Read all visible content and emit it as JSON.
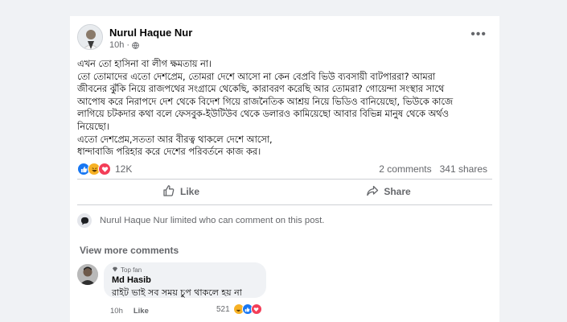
{
  "post": {
    "author": "Nurul Haque Nur",
    "time": "10h",
    "more_label": "•••",
    "lines": [
      "এখন তো হাসিনা বা লীগ ক্ষমতায় না।",
      "তো তোমাদের এতো দেশপ্রেম, তোমরা দেশে আসো না কেন বেপ্রবি ভিউ ব্যবসায়ী বাটপাররা? আমরা",
      "জীবনের ঝুঁকি নিয়ে রাজপথের সংগ্রামে থেকেছি, কারাবরণ করেছি আর তোমরা? গোয়েন্দা সংস্থার সাথে",
      "আপোষ করে নিরাপদে দেশ থেকে বিদেশ গিয়ে রাজনৈতিক আশ্রয় নিয়ে ভিডিও বানিয়েছো, ভিউকে কাজে",
      "লাগিয়ে চটকদার কথা বলে ফেসবুক-ইউটিউব থেকে ডলারও কামিয়েছো আবার বিভিন্ন মানুষ থেকে অর্থও",
      "নিয়েছো।",
      "এতো দেশপ্রেম,সততা আর বীরত্ব থাকলে দেশে আসো,",
      "ধান্দাবাজি পরিহার করে দেশের পরিবর্তনে কাজ কর।"
    ],
    "reaction_count": "12K",
    "comments_count": "2 comments",
    "shares_count": "341 shares"
  },
  "actions": {
    "like": "Like",
    "share": "Share"
  },
  "limited_notice": "Nurul Haque Nur limited who can comment on this post.",
  "view_more": "View more comments",
  "comment": {
    "badge": "Top fan",
    "name": "Md Hasib",
    "text": "রাইট ভাই সব সময় চুপ থাকলে হয় না",
    "time": "10h",
    "like_label": "Like",
    "reaction_count": "521"
  },
  "colors": {
    "like": "#1877f2",
    "haha": "#f7b125",
    "love": "#f33e58"
  }
}
